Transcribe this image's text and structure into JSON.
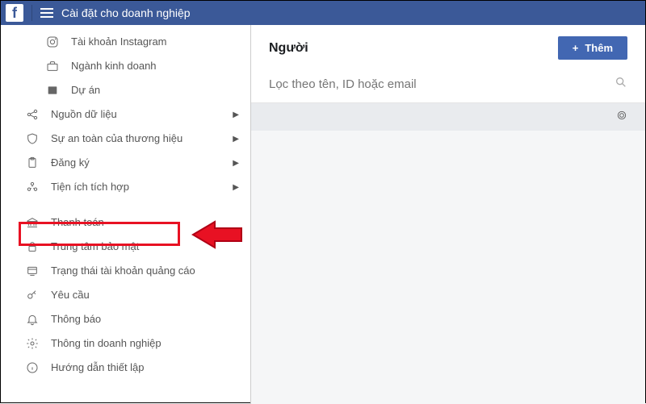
{
  "header": {
    "title": "Cài đặt cho doanh nghiệp"
  },
  "sidebar": {
    "items": [
      {
        "label": "Tài khoản Instagram",
        "sub": true
      },
      {
        "label": "Ngành kinh doanh",
        "sub": true
      },
      {
        "label": "Dự án",
        "sub": true
      },
      {
        "label": "Nguồn dữ liệu",
        "expandable": true
      },
      {
        "label": "Sự an toàn của thương hiệu",
        "expandable": true
      },
      {
        "label": "Đăng ký",
        "expandable": true
      },
      {
        "label": "Tiện ích tích hợp",
        "expandable": true
      },
      {
        "label": "Thanh toán"
      },
      {
        "label": "Trung tâm bảo mật"
      },
      {
        "label": "Trạng thái tài khoản quảng cáo"
      },
      {
        "label": "Yêu cầu"
      },
      {
        "label": "Thông báo"
      },
      {
        "label": "Thông tin doanh nghiệp"
      },
      {
        "label": "Hướng dẫn thiết lập"
      }
    ]
  },
  "content": {
    "heading": "Người",
    "add_button": "Thêm",
    "search_placeholder": "Lọc theo tên, ID hoặc email"
  }
}
